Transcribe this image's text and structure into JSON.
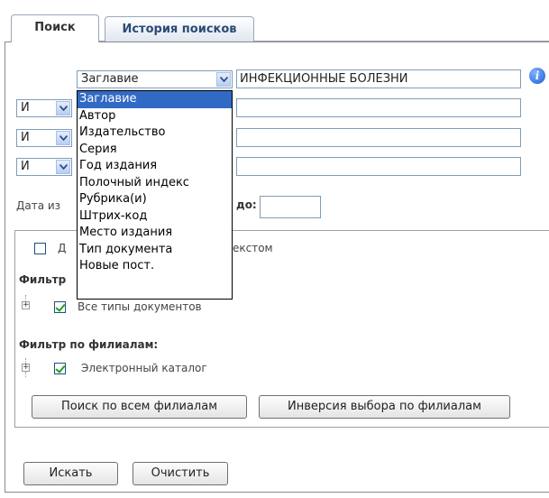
{
  "tabs": {
    "search": "Поиск",
    "history": "История поисков"
  },
  "search": {
    "field_select": "Заглавие",
    "query_value": "ИНФЕКЦИОННЫЕ БОЛЕЗНИ",
    "info_icon_glyph": "i",
    "rows": [
      {
        "operator": "И"
      },
      {
        "operator": "И"
      },
      {
        "operator": "И"
      }
    ],
    "date_label_prefix": "Дата из",
    "date_label_suffix": "до:"
  },
  "dropdown": {
    "options": [
      "Заглавие",
      "Автор",
      "Издательство",
      "Серия",
      "Год издания",
      "Полочный индекс",
      "Рубрика(и)",
      "Штрих-код",
      "Место издания",
      "Тип документа",
      "Новые пост."
    ],
    "selected_index": 0
  },
  "filters": {
    "fulltext_label_prefix": "Д",
    "fulltext_label_suffix": "екстом",
    "doc_filter_label": "Фильтр",
    "doc_types_label": "Все типы документов",
    "branch_filter_label": "Фильтр по филиалам:",
    "branch_item_label": "Электронный каталог",
    "tree_expand_glyph": "+"
  },
  "buttons": {
    "search_all_branches": "Поиск по всем филиалам",
    "invert_branches": "Инверсия выбора по филиалам",
    "search": "Искать",
    "clear": "Очистить"
  }
}
